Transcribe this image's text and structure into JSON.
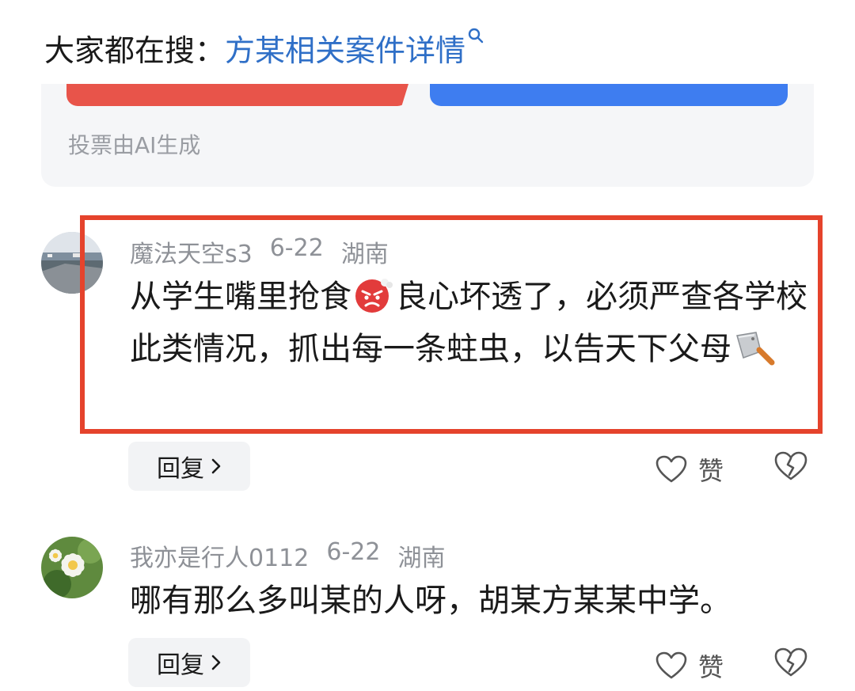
{
  "search_hint": {
    "prefix": "大家都在搜：",
    "query": "方某相关案件详情",
    "icon": "search-icon"
  },
  "vote": {
    "note": "投票由AI生成",
    "colors": {
      "left_bar": "#e8544a",
      "right_bar": "#3e7df0"
    }
  },
  "comments": [
    {
      "username": "魔法天空s3",
      "date": "6-22",
      "location": "湖南",
      "text_part1": "从学生嘴里抢食",
      "emoji1": "angry-face-emoji",
      "text_part2": "良心坏透了，必须严查各学校此类情况，抓出每一条蛀虫，以告天下父母",
      "emoji2": "cleaver-knife-emoji",
      "reply_label": "回复",
      "like_label": "赞",
      "highlighted": true
    },
    {
      "username": "我亦是行人0112",
      "date": "6-22",
      "location": "湖南",
      "text": "哪有那么多叫某的人呀，胡某方某某中学。",
      "reply_label": "回复",
      "like_label": "赞",
      "highlighted": false
    }
  ],
  "colors": {
    "link": "#2f6fc7",
    "highlight_border": "#e5432c",
    "meta_text": "#8e9197"
  }
}
